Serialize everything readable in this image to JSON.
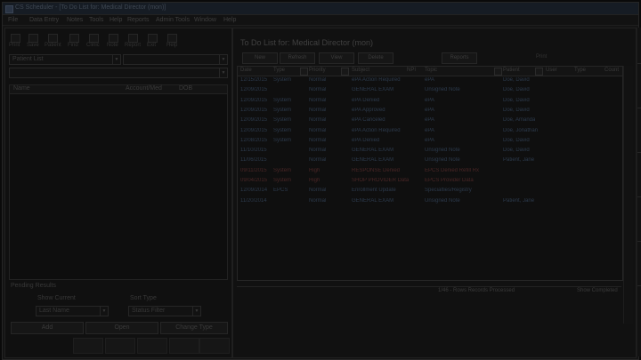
{
  "window": {
    "title": "CS Scheduler - [To Do List for: Medical Director (mon)]"
  },
  "menu": [
    "File",
    "Data Entry",
    "Notes",
    "Tools",
    "Help",
    "Reports",
    "Admin Tools",
    "Window",
    "Help"
  ],
  "left": {
    "toolbar": [
      "Print",
      "Save",
      "Patient",
      "Find",
      "Clinic",
      "Note",
      "Report",
      "Exit",
      "Help"
    ],
    "patient_select": "Patient List",
    "list_cols": [
      "Name",
      "Account/Med",
      "DOB"
    ],
    "pending": {
      "title": "Pending Results",
      "radio1": "Show Current",
      "radio2": "Show All",
      "sort_by": "Sort Type",
      "sort_value": "Last Name",
      "filter_value": "Status Filter"
    },
    "actions": [
      "Add",
      "Open",
      "Change Type"
    ]
  },
  "right": {
    "title": "To Do List for: Medical Director (mon)",
    "buttons": [
      "New",
      "Refresh",
      "View",
      "Delete",
      "Reports",
      "Print"
    ],
    "columns": [
      "Date",
      "Type",
      "Priority",
      "Subject",
      "NPI",
      "Topic",
      "Patient",
      "User",
      "Type",
      "Count"
    ],
    "rows": [
      {
        "date": "12/15/2015",
        "type": "System",
        "priority": "Normal",
        "subject": "ePA Action Required",
        "topic": "ePA",
        "patient": "Doe, David",
        "alert": false
      },
      {
        "date": "12/09/2015",
        "type": "",
        "priority": "Normal",
        "subject": "GENERAL EXAM",
        "topic": "Unsigned Note",
        "patient": "Doe, David",
        "alert": false
      },
      {
        "date": "12/09/2015",
        "type": "System",
        "priority": "Normal",
        "subject": "ePA Denied",
        "topic": "ePA",
        "patient": "Doe, David",
        "alert": false
      },
      {
        "date": "12/09/2015",
        "type": "System",
        "priority": "Normal",
        "subject": "ePA Approved",
        "topic": "ePA",
        "patient": "Doe, David",
        "alert": false
      },
      {
        "date": "12/09/2015",
        "type": "System",
        "priority": "Normal",
        "subject": "ePA Canceled",
        "topic": "ePA",
        "patient": "Doe, Amanda",
        "alert": false
      },
      {
        "date": "12/09/2015",
        "type": "System",
        "priority": "Normal",
        "subject": "ePA Action Required",
        "topic": "ePA",
        "patient": "Doe, Jonathan",
        "alert": false
      },
      {
        "date": "12/08/2015",
        "type": "System",
        "priority": "Normal",
        "subject": "ePA Denied",
        "topic": "ePA",
        "patient": "Doe, David",
        "alert": false
      },
      {
        "date": "11/10/2015",
        "type": "",
        "priority": "Normal",
        "subject": "GENERAL EXAM",
        "topic": "Unsigned Note",
        "patient": "Doe, David",
        "alert": false
      },
      {
        "date": "11/06/2015",
        "type": "",
        "priority": "Normal",
        "subject": "GENERAL EXAM",
        "topic": "Unsigned Note",
        "patient": "Patient, Jane",
        "alert": false
      },
      {
        "date": "09/11/2015",
        "type": "System",
        "priority": "High",
        "subject": "RESPONSE Denied",
        "topic": "EPCS Denied Refill Rx",
        "patient": "",
        "alert": true
      },
      {
        "date": "09/04/2015",
        "type": "System",
        "priority": "High",
        "subject": "SHOP PROVIDER Data",
        "topic": "EPCS Provider Data",
        "patient": "",
        "alert": true
      },
      {
        "date": "12/09/2014",
        "type": "EPCS",
        "priority": "Normal",
        "subject": "Enrollment Update",
        "topic": "Specialties/Registry",
        "patient": "",
        "alert": false
      },
      {
        "date": "11/20/2014",
        "type": "",
        "priority": "Normal",
        "subject": "GENERAL EXAM",
        "topic": "Unsigned Note",
        "patient": "Patient, Jane",
        "alert": false
      }
    ],
    "status_center": "1/46 - Rows Records Processed",
    "status_right": "Show Completed"
  }
}
